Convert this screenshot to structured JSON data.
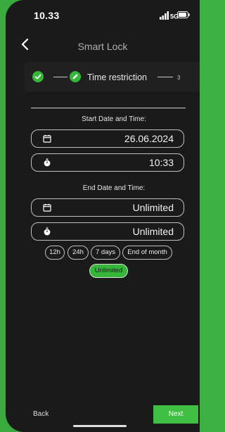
{
  "status_bar": {
    "time": "10.33",
    "network": "5G"
  },
  "header": {
    "title": "Smart Lock"
  },
  "stepper": {
    "current_label": "Time restriction",
    "next_step": "3"
  },
  "start": {
    "label": "Start Date and Time:",
    "date": "26.06.2024",
    "time": "10:33"
  },
  "end": {
    "label": "End Date and Time:",
    "date": "Unlimited",
    "time": "Unlimited"
  },
  "chips": [
    "12h",
    "24h",
    "7 days",
    "End of month",
    "Unlimited"
  ],
  "selected_chip": "Unlimited",
  "footer": {
    "back": "Back",
    "next": "Next"
  },
  "colors": {
    "accent": "#35b83a",
    "background": "#1a1a1a",
    "frame": "#3aaa3f"
  },
  "icons": {
    "back": "chevron-left-icon",
    "done": "check-icon",
    "edit": "pencil-icon",
    "date": "calendar-icon",
    "time": "stopwatch-icon"
  }
}
